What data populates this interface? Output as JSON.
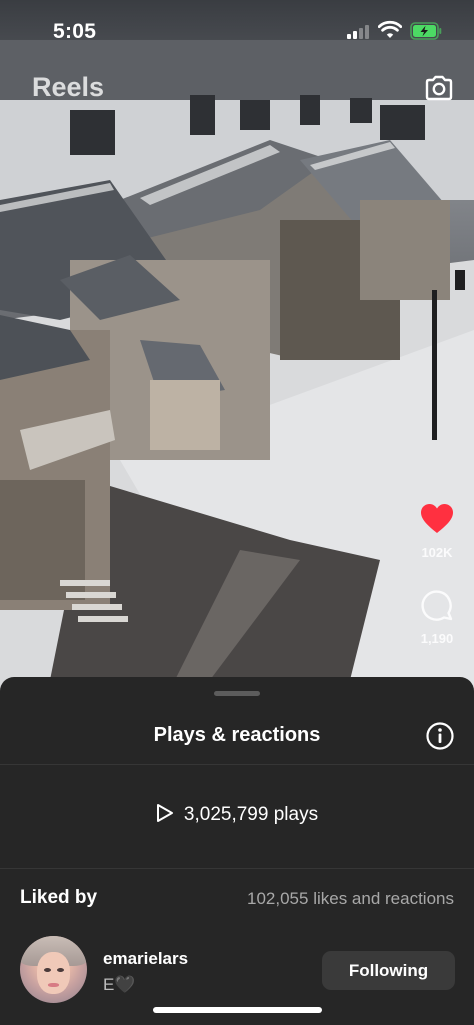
{
  "status_bar": {
    "time": "5:05",
    "signal_icon": "cellular-signal-icon",
    "wifi_icon": "wifi-icon",
    "battery_icon": "battery-charging-icon",
    "battery_color": "#4cd964"
  },
  "header": {
    "title": "Reels",
    "camera_icon": "camera-icon"
  },
  "actions": {
    "like_icon": "heart-icon",
    "like_color": "#ff3040",
    "like_count": "102K",
    "comment_icon": "comment-bubble-icon",
    "comment_count": "1,190"
  },
  "sheet": {
    "title": "Plays & reactions",
    "info_icon": "info-icon",
    "play_icon": "play-icon",
    "plays": "3,025,799 plays",
    "liked_by_label": "Liked by",
    "likes_reactions": "102,055 likes and reactions",
    "users": [
      {
        "username": "emarielars",
        "full_name": "E🖤",
        "follow_label": "Following"
      }
    ]
  }
}
